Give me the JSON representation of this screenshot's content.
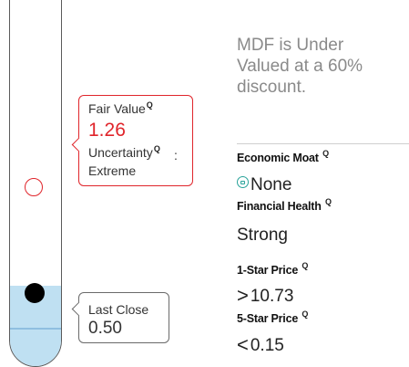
{
  "valuation": {
    "fair_value_label": "Fair Value",
    "fair_value": "1.26",
    "uncertainty_label": "Uncertainty",
    "uncertainty_colon": ":",
    "uncertainty_value": "Extreme",
    "last_close_label": "Last Close",
    "last_close": "0.50",
    "info_icon_glyph": "Q"
  },
  "summary": {
    "headline": "MDF is Under Valued at a 60% discount."
  },
  "metrics": {
    "moat_label": "Economic Moat",
    "moat_icon": "moat-badge-icon",
    "moat_value": "None",
    "health_label": "Financial Health",
    "health_value": "Strong",
    "one_star_label": "1-Star Price",
    "one_star_cmp": ">",
    "one_star_value": "10.73",
    "five_star_label": "5-Star Price",
    "five_star_cmp": "<",
    "five_star_value": "0.15"
  },
  "colors": {
    "accent_red": "#e0252b",
    "tube_fill": "#bfe0f2",
    "moat_teal": "#2aa39a",
    "headline_gray": "#8a8a8a"
  }
}
